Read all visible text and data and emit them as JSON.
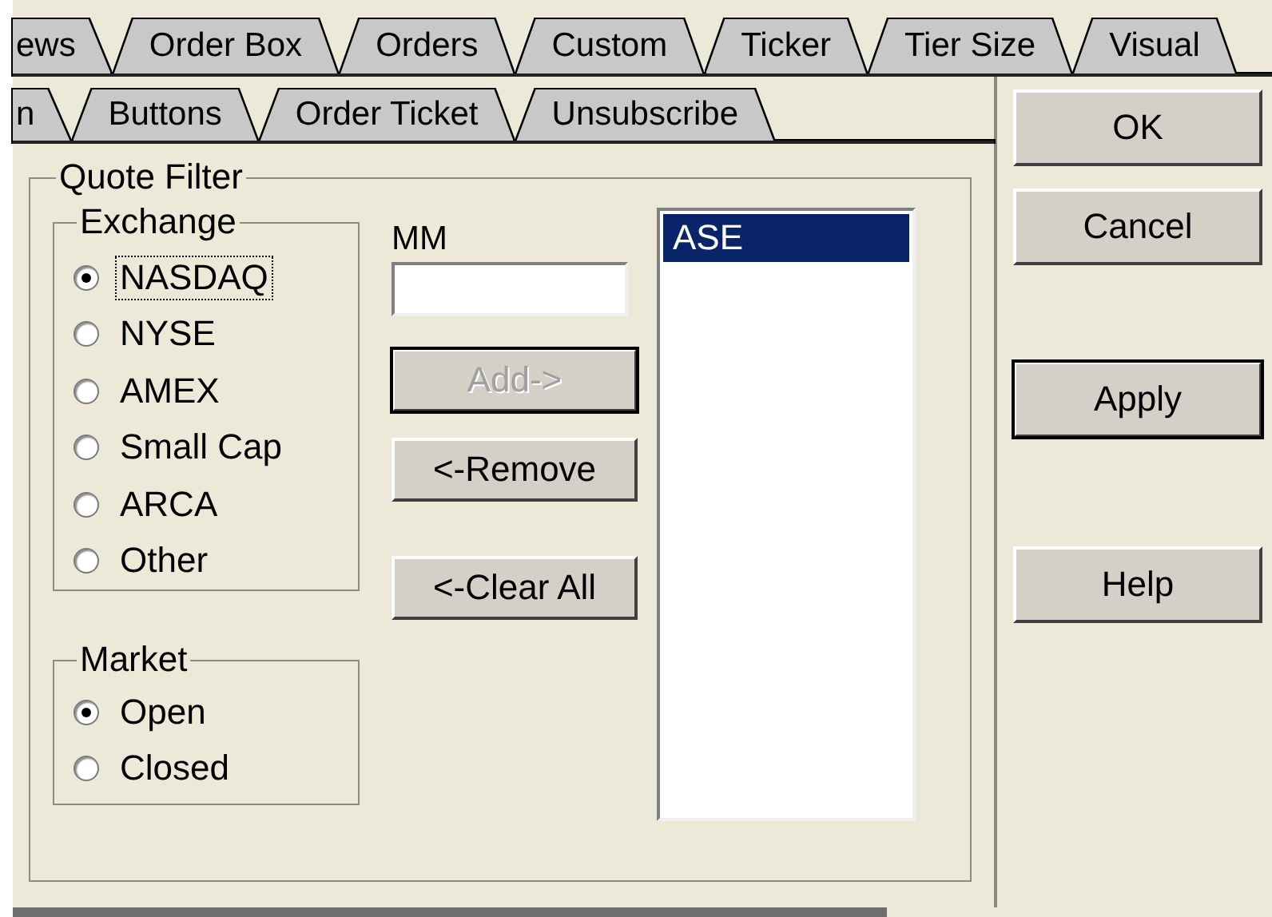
{
  "tab_rows": [
    {
      "tabs": [
        {
          "label": "ews",
          "selected": false
        },
        {
          "label": "Order Box",
          "selected": false
        },
        {
          "label": "Orders",
          "selected": false
        },
        {
          "label": "Custom",
          "selected": false
        },
        {
          "label": "Ticker",
          "selected": false
        },
        {
          "label": "Tier Size",
          "selected": false
        },
        {
          "label": "Visual",
          "selected": false
        }
      ]
    },
    {
      "tabs": [
        {
          "label": "n",
          "selected": false
        },
        {
          "label": "Buttons",
          "selected": false
        },
        {
          "label": "Order Ticket",
          "selected": false
        },
        {
          "label": "Unsubscribe",
          "selected": false
        }
      ]
    }
  ],
  "quote_filter": {
    "title": "Quote Filter",
    "exchange": {
      "title": "Exchange",
      "options": [
        {
          "label": "NASDAQ",
          "selected": true,
          "focused": true
        },
        {
          "label": "NYSE",
          "selected": false,
          "focused": false
        },
        {
          "label": "AMEX",
          "selected": false,
          "focused": false
        },
        {
          "label": "Small Cap",
          "selected": false,
          "focused": false
        },
        {
          "label": "ARCA",
          "selected": false,
          "focused": false
        },
        {
          "label": "Other",
          "selected": false,
          "focused": false
        }
      ]
    },
    "market": {
      "title": "Market",
      "options": [
        {
          "label": "Open",
          "selected": true,
          "focused": false
        },
        {
          "label": "Closed",
          "selected": false,
          "focused": false
        }
      ]
    },
    "mm_label": "MM",
    "buttons": [
      {
        "label": "Add->",
        "disabled": true,
        "default": true
      },
      {
        "label": "<-Remove",
        "disabled": false,
        "default": false
      },
      {
        "label": "<-Clear All",
        "disabled": false,
        "default": false
      }
    ],
    "list": [
      {
        "label": "ASE",
        "selected": true
      }
    ]
  },
  "dialog_buttons": [
    {
      "label": "OK",
      "default": false
    },
    {
      "label": "Cancel",
      "default": false
    },
    {
      "label": "Apply",
      "default": true
    },
    {
      "label": "Help",
      "default": false
    }
  ]
}
